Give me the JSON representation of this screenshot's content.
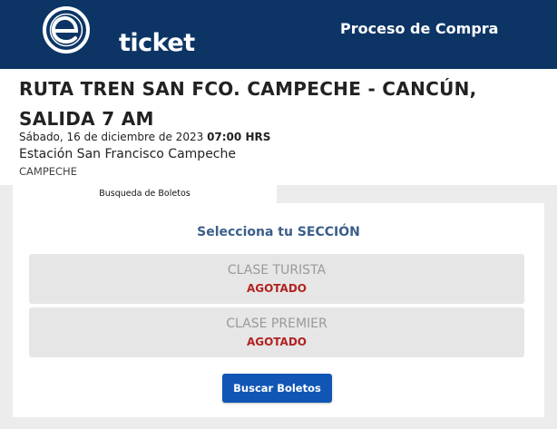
{
  "header": {
    "logo_text": "ticket",
    "title": "Proceso de Compra"
  },
  "event": {
    "title": "RUTA TREN SAN FCO. CAMPECHE - CANCÚN, SALIDA 7 AM",
    "date_text": "Sábado, 16 de diciembre de 2023",
    "time_text": "07:00 HRS",
    "venue": "Estación San Francisco Campeche",
    "city": "CAMPECHE"
  },
  "tabs": [
    {
      "label": "Busqueda de Boletos"
    }
  ],
  "section_picker": {
    "title": "Selecciona tu SECCIÓN",
    "sections": [
      {
        "name": "CLASE TURISTA",
        "status": "AGOTADO"
      },
      {
        "name": "CLASE PREMIER",
        "status": "AGOTADO"
      }
    ],
    "search_button_label": "Buscar Boletos"
  },
  "colors": {
    "header_bg": "#0c3566",
    "section_title": "#3b5f8a",
    "sold_out": "#b22222",
    "button": "#1156b5"
  }
}
